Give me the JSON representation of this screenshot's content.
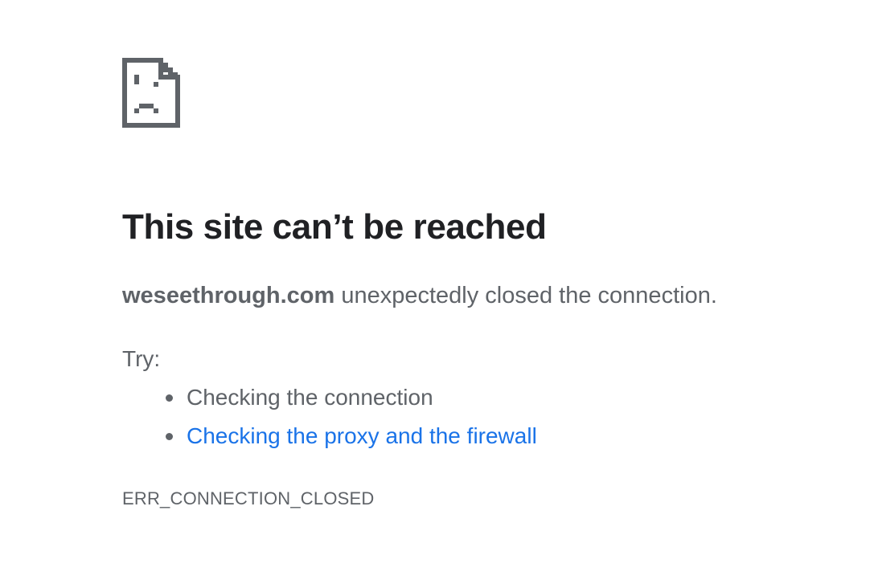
{
  "icon": "sad-page-icon",
  "title": "This site can’t be reached",
  "summary": {
    "host": "weseethrough.com",
    "message": " unexpectedly closed the connection."
  },
  "try_label": "Try:",
  "suggestions": [
    {
      "label": "Checking the connection"
    },
    {
      "label": "Checking the proxy and the firewall"
    }
  ],
  "error_code": "ERR_CONNECTION_CLOSED",
  "colors": {
    "title": "#202124",
    "body": "#5f6368",
    "link": "#1a73e8",
    "icon": "#5f6368"
  }
}
